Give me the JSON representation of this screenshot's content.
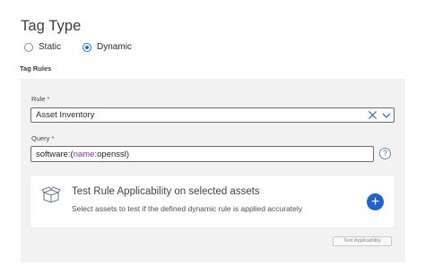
{
  "header": {
    "title": "Tag Type"
  },
  "tag_type": {
    "options": [
      {
        "label": "Static",
        "selected": false
      },
      {
        "label": "Dynamic",
        "selected": true
      }
    ]
  },
  "tag_rules": {
    "section_label": "Tag Rules",
    "rule": {
      "label": "Rule",
      "required_mark": "*",
      "value": "Asset Inventory"
    },
    "query": {
      "label": "Query",
      "required_mark": "*",
      "prefix": "software:(",
      "key": "name",
      "rest": ":openssl)"
    },
    "help_icon_glyph": "?"
  },
  "applicability_card": {
    "title": "Test Rule Applicability on selected assets",
    "description": "Select assets to test if the defined dynamic rule is applied accurately",
    "add_glyph": "+"
  },
  "test_button": {
    "label": "Test Applicability"
  },
  "colors": {
    "accent": "#1f64c8",
    "required": "#d62b2b",
    "query_key": "#8a2eb4",
    "panel_bg": "#f2f2f3"
  }
}
